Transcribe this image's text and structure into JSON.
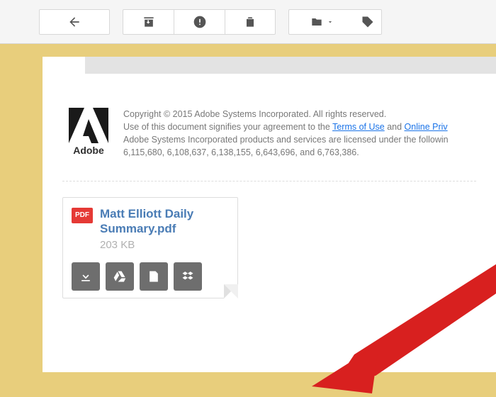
{
  "legal": {
    "copyright": "Copyright © 2015 Adobe Systems Incorporated. All rights reserved.",
    "line2_prefix": "Use of this document signifies your agreement to the ",
    "terms_link": "Terms of Use",
    "line2_middle": " and ",
    "privacy_link": "Online Priv",
    "line3": "Adobe Systems Incorporated products and services are licensed under the followin",
    "line4": "6,115,680, 6,108,637, 6,138,155, 6,643,696, and 6,763,386."
  },
  "adobe": {
    "brand": "Adobe"
  },
  "attachment": {
    "badge": "PDF",
    "filename": "Matt Elliott Daily Summary.pdf",
    "size": "203 KB"
  }
}
